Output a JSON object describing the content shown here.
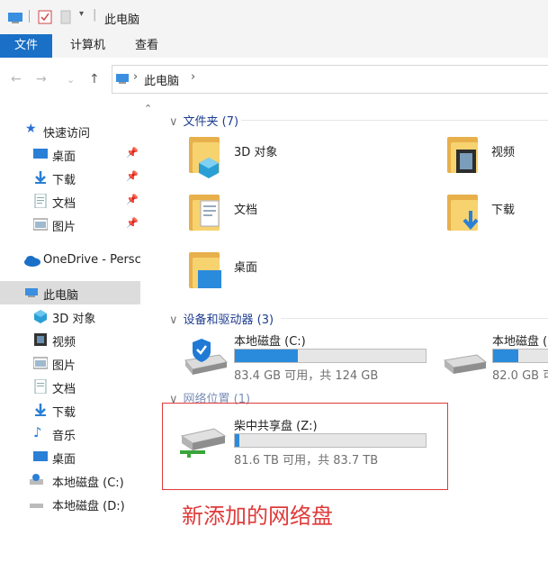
{
  "titlebar": {
    "title": "此电脑"
  },
  "ribbon": {
    "file_tab": "文件",
    "tabs": [
      "计算机",
      "查看"
    ]
  },
  "address": {
    "path": "此电脑",
    "separator": "›"
  },
  "nav": {
    "quick_access": "快速访问",
    "items": [
      {
        "label": "桌面",
        "pinned": true
      },
      {
        "label": "下载",
        "pinned": true
      },
      {
        "label": "文档",
        "pinned": true
      },
      {
        "label": "图片",
        "pinned": true
      }
    ],
    "onedrive": "OneDrive - Persc",
    "this_pc": "此电脑",
    "pc_items": [
      "3D 对象",
      "视频",
      "图片",
      "文档",
      "下载",
      "音乐",
      "桌面",
      "本地磁盘 (C:)",
      "本地磁盘 (D:)"
    ]
  },
  "content": {
    "folders_header": "文件夹 (7)",
    "folders": [
      "3D 对象",
      "视频",
      "文档",
      "下载",
      "桌面"
    ],
    "devices_header": "设备和驱动器 (3)",
    "drives": [
      {
        "label": "本地磁盘 (C:)",
        "info": "83.4 GB 可用，共 124 GB",
        "used_fraction": 0.33
      },
      {
        "label": "本地磁盘 (",
        "info": "82.0 GB 可",
        "used_fraction": 0.35
      }
    ],
    "network_header": "网络位置 (1)",
    "network_drive": {
      "label": "柴中共享盘 (Z:)",
      "info": "81.6 TB 可用，共 83.7 TB",
      "used_fraction": 0.025
    }
  },
  "annotation": {
    "text": "新添加的网络盘",
    "color": "#e03a3a"
  },
  "colors": {
    "accent": "#1a6fc6",
    "folder_back": "#e8b04b",
    "folder_front": "#f6d36f",
    "bar_fill": "#2a8bdc"
  }
}
